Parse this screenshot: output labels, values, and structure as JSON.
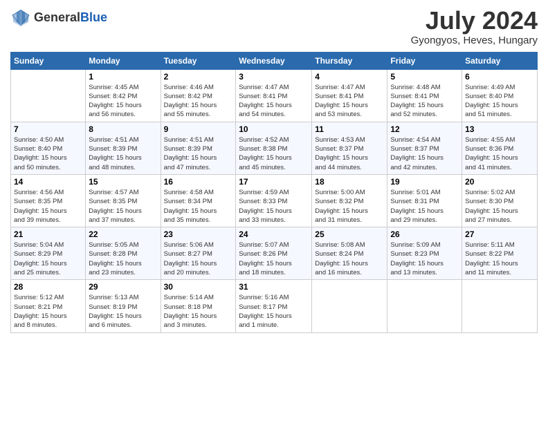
{
  "logo": {
    "general": "General",
    "blue": "Blue"
  },
  "header": {
    "month": "July 2024",
    "location": "Gyongyos, Heves, Hungary"
  },
  "weekdays": [
    "Sunday",
    "Monday",
    "Tuesday",
    "Wednesday",
    "Thursday",
    "Friday",
    "Saturday"
  ],
  "weeks": [
    [
      {
        "day": "",
        "info": ""
      },
      {
        "day": "1",
        "info": "Sunrise: 4:45 AM\nSunset: 8:42 PM\nDaylight: 15 hours\nand 56 minutes."
      },
      {
        "day": "2",
        "info": "Sunrise: 4:46 AM\nSunset: 8:42 PM\nDaylight: 15 hours\nand 55 minutes."
      },
      {
        "day": "3",
        "info": "Sunrise: 4:47 AM\nSunset: 8:41 PM\nDaylight: 15 hours\nand 54 minutes."
      },
      {
        "day": "4",
        "info": "Sunrise: 4:47 AM\nSunset: 8:41 PM\nDaylight: 15 hours\nand 53 minutes."
      },
      {
        "day": "5",
        "info": "Sunrise: 4:48 AM\nSunset: 8:41 PM\nDaylight: 15 hours\nand 52 minutes."
      },
      {
        "day": "6",
        "info": "Sunrise: 4:49 AM\nSunset: 8:40 PM\nDaylight: 15 hours\nand 51 minutes."
      }
    ],
    [
      {
        "day": "7",
        "info": "Sunrise: 4:50 AM\nSunset: 8:40 PM\nDaylight: 15 hours\nand 50 minutes."
      },
      {
        "day": "8",
        "info": "Sunrise: 4:51 AM\nSunset: 8:39 PM\nDaylight: 15 hours\nand 48 minutes."
      },
      {
        "day": "9",
        "info": "Sunrise: 4:51 AM\nSunset: 8:39 PM\nDaylight: 15 hours\nand 47 minutes."
      },
      {
        "day": "10",
        "info": "Sunrise: 4:52 AM\nSunset: 8:38 PM\nDaylight: 15 hours\nand 45 minutes."
      },
      {
        "day": "11",
        "info": "Sunrise: 4:53 AM\nSunset: 8:37 PM\nDaylight: 15 hours\nand 44 minutes."
      },
      {
        "day": "12",
        "info": "Sunrise: 4:54 AM\nSunset: 8:37 PM\nDaylight: 15 hours\nand 42 minutes."
      },
      {
        "day": "13",
        "info": "Sunrise: 4:55 AM\nSunset: 8:36 PM\nDaylight: 15 hours\nand 41 minutes."
      }
    ],
    [
      {
        "day": "14",
        "info": "Sunrise: 4:56 AM\nSunset: 8:35 PM\nDaylight: 15 hours\nand 39 minutes."
      },
      {
        "day": "15",
        "info": "Sunrise: 4:57 AM\nSunset: 8:35 PM\nDaylight: 15 hours\nand 37 minutes."
      },
      {
        "day": "16",
        "info": "Sunrise: 4:58 AM\nSunset: 8:34 PM\nDaylight: 15 hours\nand 35 minutes."
      },
      {
        "day": "17",
        "info": "Sunrise: 4:59 AM\nSunset: 8:33 PM\nDaylight: 15 hours\nand 33 minutes."
      },
      {
        "day": "18",
        "info": "Sunrise: 5:00 AM\nSunset: 8:32 PM\nDaylight: 15 hours\nand 31 minutes."
      },
      {
        "day": "19",
        "info": "Sunrise: 5:01 AM\nSunset: 8:31 PM\nDaylight: 15 hours\nand 29 minutes."
      },
      {
        "day": "20",
        "info": "Sunrise: 5:02 AM\nSunset: 8:30 PM\nDaylight: 15 hours\nand 27 minutes."
      }
    ],
    [
      {
        "day": "21",
        "info": "Sunrise: 5:04 AM\nSunset: 8:29 PM\nDaylight: 15 hours\nand 25 minutes."
      },
      {
        "day": "22",
        "info": "Sunrise: 5:05 AM\nSunset: 8:28 PM\nDaylight: 15 hours\nand 23 minutes."
      },
      {
        "day": "23",
        "info": "Sunrise: 5:06 AM\nSunset: 8:27 PM\nDaylight: 15 hours\nand 20 minutes."
      },
      {
        "day": "24",
        "info": "Sunrise: 5:07 AM\nSunset: 8:26 PM\nDaylight: 15 hours\nand 18 minutes."
      },
      {
        "day": "25",
        "info": "Sunrise: 5:08 AM\nSunset: 8:24 PM\nDaylight: 15 hours\nand 16 minutes."
      },
      {
        "day": "26",
        "info": "Sunrise: 5:09 AM\nSunset: 8:23 PM\nDaylight: 15 hours\nand 13 minutes."
      },
      {
        "day": "27",
        "info": "Sunrise: 5:11 AM\nSunset: 8:22 PM\nDaylight: 15 hours\nand 11 minutes."
      }
    ],
    [
      {
        "day": "28",
        "info": "Sunrise: 5:12 AM\nSunset: 8:21 PM\nDaylight: 15 hours\nand 8 minutes."
      },
      {
        "day": "29",
        "info": "Sunrise: 5:13 AM\nSunset: 8:19 PM\nDaylight: 15 hours\nand 6 minutes."
      },
      {
        "day": "30",
        "info": "Sunrise: 5:14 AM\nSunset: 8:18 PM\nDaylight: 15 hours\nand 3 minutes."
      },
      {
        "day": "31",
        "info": "Sunrise: 5:16 AM\nSunset: 8:17 PM\nDaylight: 15 hours\nand 1 minute."
      },
      {
        "day": "",
        "info": ""
      },
      {
        "day": "",
        "info": ""
      },
      {
        "day": "",
        "info": ""
      }
    ]
  ]
}
